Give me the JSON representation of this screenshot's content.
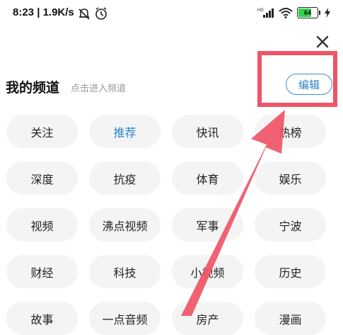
{
  "status_bar": {
    "time": "8:23",
    "speed": "1.9K/s",
    "battery": "64",
    "icons": [
      "mute-bell-icon",
      "alarm-icon",
      "hd-signal-icon",
      "wifi-icon",
      "battery-icon",
      "charging-icon"
    ]
  },
  "header": {
    "title": "我的频道",
    "subtitle": "点击进入频道",
    "edit_label": "编辑"
  },
  "channels": [
    {
      "label": "关注",
      "active": false
    },
    {
      "label": "推荐",
      "active": true
    },
    {
      "label": "快讯",
      "active": false
    },
    {
      "label": "热榜",
      "active": false
    },
    {
      "label": "深度",
      "active": false
    },
    {
      "label": "抗疫",
      "active": false
    },
    {
      "label": "体育",
      "active": false
    },
    {
      "label": "娱乐",
      "active": false
    },
    {
      "label": "视频",
      "active": false
    },
    {
      "label": "沸点视频",
      "active": false
    },
    {
      "label": "军事",
      "active": false
    },
    {
      "label": "宁波",
      "active": false
    },
    {
      "label": "财经",
      "active": false
    },
    {
      "label": "科技",
      "active": false
    },
    {
      "label": "小视频",
      "active": false
    },
    {
      "label": "历史",
      "active": false
    },
    {
      "label": "故事",
      "active": false
    },
    {
      "label": "一点音频",
      "active": false
    },
    {
      "label": "房产",
      "active": false
    },
    {
      "label": "漫画",
      "active": false
    }
  ],
  "colors": {
    "accent": "#2f86c8",
    "highlight": "#ef5466",
    "chip_bg": "#f4f4f4",
    "battery": "#35d04d"
  }
}
